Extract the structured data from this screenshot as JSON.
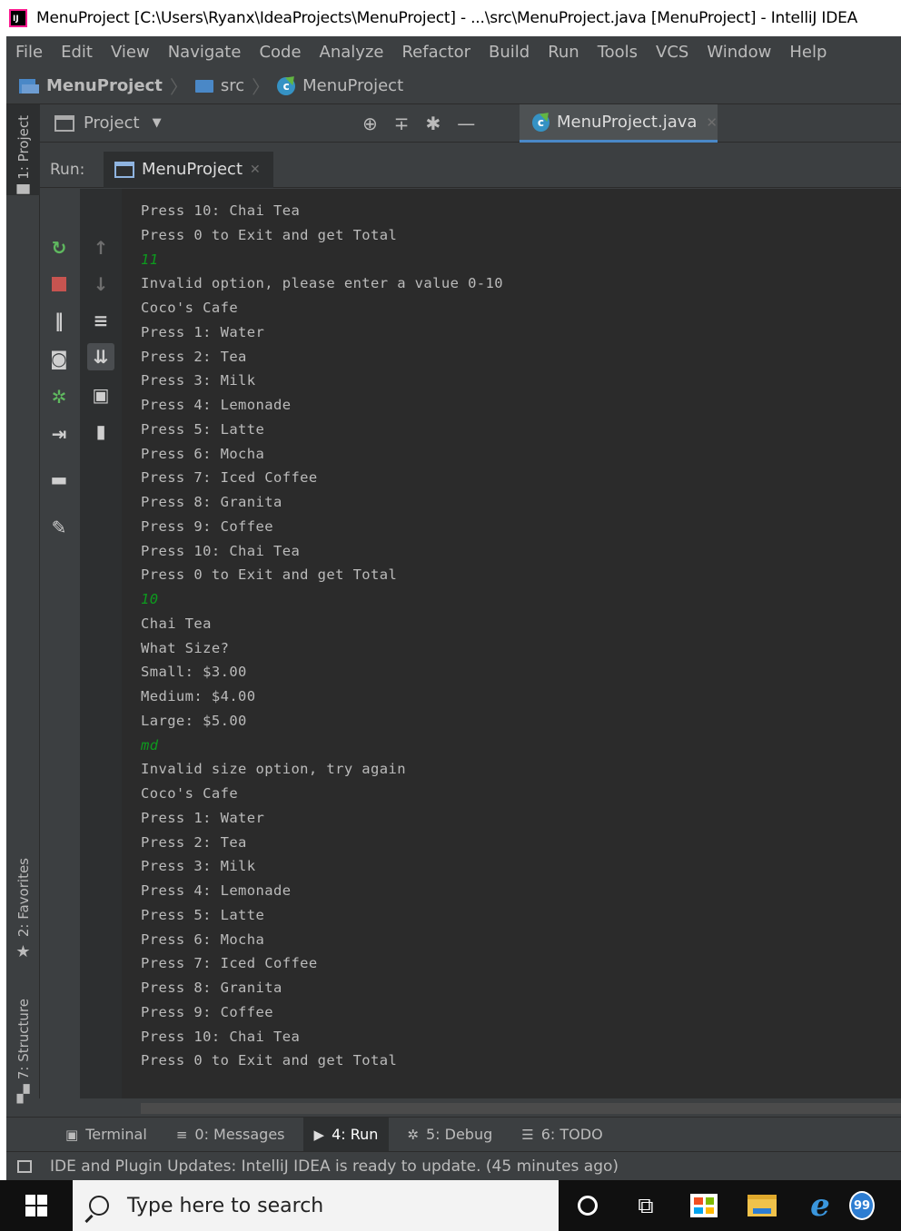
{
  "window": {
    "title": "MenuProject [C:\\Users\\Ryanx\\IdeaProjects\\MenuProject] - ...\\src\\MenuProject.java [MenuProject] - IntelliJ IDEA",
    "logo_text": "IJ"
  },
  "menubar": [
    "File",
    "Edit",
    "View",
    "Navigate",
    "Code",
    "Analyze",
    "Refactor",
    "Build",
    "Run",
    "Tools",
    "VCS",
    "Window",
    "Help"
  ],
  "breadcrumb": {
    "project": "MenuProject",
    "folder": "src",
    "file": "MenuProject"
  },
  "left_stripe": {
    "project_tab": "1: Project",
    "favorites_tab": "2: Favorites",
    "structure_tab": "7: Structure"
  },
  "project_panel": {
    "title": "Project"
  },
  "editor": {
    "active_tab": "MenuProject.java"
  },
  "run": {
    "label": "Run:",
    "tab": "MenuProject"
  },
  "console": {
    "lines": [
      {
        "text": "Press 10: Chai Tea",
        "type": "output"
      },
      {
        "text": "Press 0 to Exit and get Total",
        "type": "output"
      },
      {
        "text": "11",
        "type": "input"
      },
      {
        "text": "Invalid option, please enter a value 0-10",
        "type": "output"
      },
      {
        "text": "Coco's Cafe",
        "type": "output"
      },
      {
        "text": "Press 1: Water",
        "type": "output"
      },
      {
        "text": "Press 2: Tea",
        "type": "output"
      },
      {
        "text": "Press 3: Milk",
        "type": "output"
      },
      {
        "text": "Press 4: Lemonade",
        "type": "output"
      },
      {
        "text": "Press 5: Latte",
        "type": "output"
      },
      {
        "text": "Press 6: Mocha",
        "type": "output"
      },
      {
        "text": "Press 7: Iced Coffee",
        "type": "output"
      },
      {
        "text": "Press 8: Granita",
        "type": "output"
      },
      {
        "text": "Press 9: Coffee",
        "type": "output"
      },
      {
        "text": "Press 10: Chai Tea",
        "type": "output"
      },
      {
        "text": "Press 0 to Exit and get Total",
        "type": "output"
      },
      {
        "text": "10",
        "type": "input"
      },
      {
        "text": "Chai Tea",
        "type": "output"
      },
      {
        "text": "What Size?",
        "type": "output"
      },
      {
        "text": "Small: $3.00",
        "type": "output"
      },
      {
        "text": "Medium: $4.00",
        "type": "output"
      },
      {
        "text": "Large: $5.00",
        "type": "output"
      },
      {
        "text": "md",
        "type": "input"
      },
      {
        "text": "Invalid size option, try again",
        "type": "output"
      },
      {
        "text": "Coco's Cafe",
        "type": "output"
      },
      {
        "text": "Press 1: Water",
        "type": "output"
      },
      {
        "text": "Press 2: Tea",
        "type": "output"
      },
      {
        "text": "Press 3: Milk",
        "type": "output"
      },
      {
        "text": "Press 4: Lemonade",
        "type": "output"
      },
      {
        "text": "Press 5: Latte",
        "type": "output"
      },
      {
        "text": "Press 6: Mocha",
        "type": "output"
      },
      {
        "text": "Press 7: Iced Coffee",
        "type": "output"
      },
      {
        "text": "Press 8: Granita",
        "type": "output"
      },
      {
        "text": "Press 9: Coffee",
        "type": "output"
      },
      {
        "text": "Press 10: Chai Tea",
        "type": "output"
      },
      {
        "text": "Press 0 to Exit and get Total",
        "type": "output"
      }
    ]
  },
  "bottom_tabs": [
    {
      "label": "Terminal",
      "icon": "terminal-icon",
      "active": false
    },
    {
      "label": "0: Messages",
      "icon": "messages-icon",
      "active": false
    },
    {
      "label": "4: Run",
      "icon": "run-icon",
      "active": true
    },
    {
      "label": "5: Debug",
      "icon": "debug-icon",
      "active": false
    },
    {
      "label": "6: TODO",
      "icon": "todo-icon",
      "active": false
    }
  ],
  "status": {
    "message": "IDE and Plugin Updates: IntelliJ IDEA is ready to update. (45 minutes ago)"
  },
  "taskbar": {
    "search_placeholder": "Type here to search",
    "badge": "99"
  },
  "colors": {
    "ide_background": "#3c3f41",
    "console_background": "#2b2b2b",
    "console_text": "#bbbbbb",
    "console_input": "#0d9b1e",
    "accent": "#4a88c7"
  }
}
